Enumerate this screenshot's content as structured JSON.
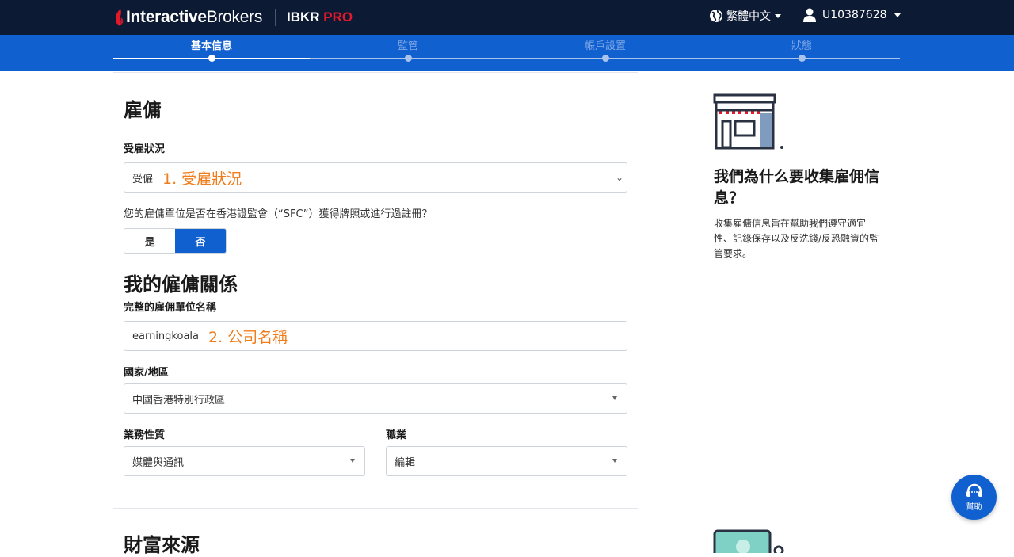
{
  "header": {
    "brand_name_bold": "Interactive",
    "brand_name_rest": "Brokers",
    "product": "IBKR",
    "product_accent": "PRO",
    "language": "繁體中文",
    "account": "U10387628"
  },
  "steps": [
    {
      "label": "基本信息",
      "active": true
    },
    {
      "label": "監管",
      "active": false
    },
    {
      "label": "帳戶設置",
      "active": false
    },
    {
      "label": "狀態",
      "active": false
    }
  ],
  "employment": {
    "title": "雇傭",
    "status_label": "受雇狀況",
    "status_value": "受僱",
    "status_annotation": "1. 受雇狀況",
    "sfc_question": "您的雇傭單位是否在香港證監會（“SFC”）獲得牌照或進行過註冊？",
    "yes_label": "是",
    "no_label": "否",
    "selected": "否"
  },
  "relationship": {
    "title": "我的僱傭關係",
    "employer_label": "完整的雇佣單位名稱",
    "employer_value": "earningkoala",
    "employer_annotation": "2. 公司名稱",
    "country_label": "國家/地區",
    "country_value": "中國香港特別行政區",
    "business_label": "業務性質",
    "business_value": "媒體與通訊",
    "occupation_label": "職業",
    "occupation_value": "編輯"
  },
  "wealth": {
    "title": "財富來源"
  },
  "info_panel": {
    "title": "我們為什么要收集雇佣信息？",
    "body": "收集雇傭信息旨在幫助我們遵守適宜性、記錄保存以及反洗錢/反恐融資的監管要求。"
  },
  "help": {
    "label": "幫助"
  },
  "colors": {
    "nav_bg": "#0d1a33",
    "step_bg": "#1060d0",
    "brand_red": "#e3192b",
    "annotation": "#f07c1a"
  }
}
